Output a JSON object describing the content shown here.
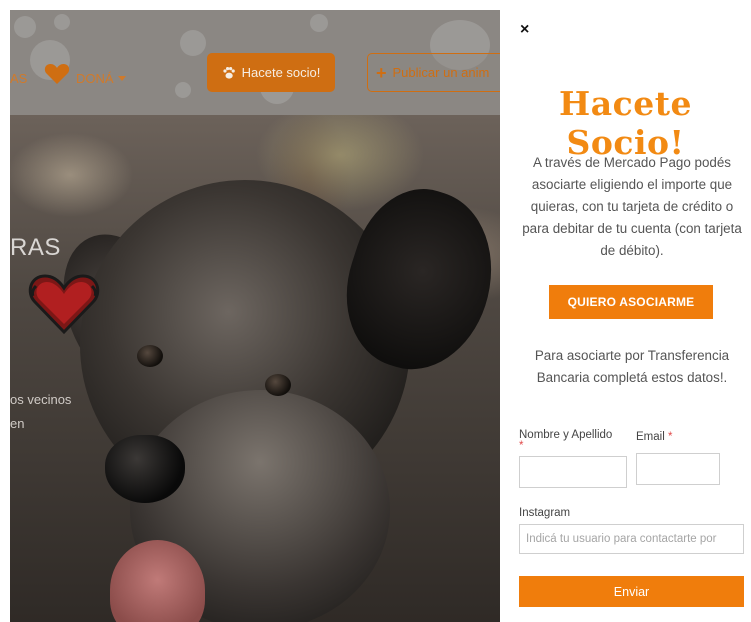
{
  "background_page": {
    "nav": {
      "partial_item": "AS",
      "donate_label": "DONÁ",
      "heart_icon": "heart-icon",
      "caret_icon": "chevron-down-icon"
    },
    "socio_button": {
      "label": "Hacete socio!",
      "icon": "paw-icon"
    },
    "publicar_button": {
      "label": "Publicar un anim",
      "icon": "plus-icon"
    },
    "hero": {
      "title_partial": "RAS",
      "line1_partial": "os vecinos",
      "line2_partial": "en",
      "heart_icon": "heart-icon"
    },
    "colors": {
      "brand_orange": "#cf6e12"
    }
  },
  "panel": {
    "close_label": "×",
    "title": "Hacete Socio!",
    "description": "A través de Mercado Pago podés asociarte eligiendo el importe que quieras, con tu tarjeta de crédito o para debitar de tu cuenta (con tarjeta de débito).",
    "cta_label": "QUIERO ASOCIARME",
    "transfer_text": "Para asociarte por Transferencia Bancaria completá estos datos!.",
    "form": {
      "name_label": "Nombre y Apellido",
      "name_required": "*",
      "name_value": "",
      "email_label": "Email",
      "email_required": "*",
      "email_value": "",
      "instagram_label": "Instagram",
      "instagram_placeholder": "Indicá tu usuario para contactarte por",
      "submit_label": "Enviar"
    },
    "colors": {
      "title_orange": "#f28a13",
      "button_orange": "#f07d0c"
    }
  }
}
